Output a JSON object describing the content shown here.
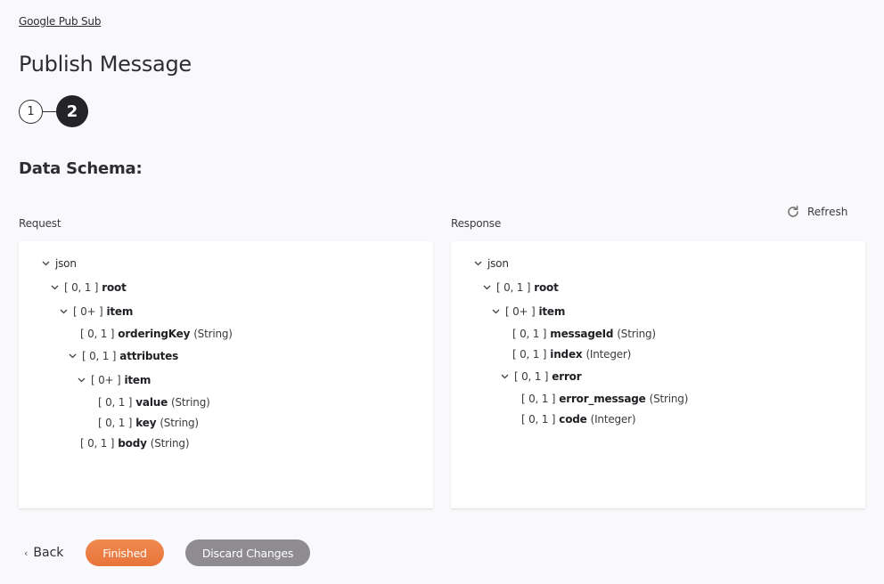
{
  "breadcrumb": "Google Pub Sub",
  "title": "Publish Message",
  "stepper": {
    "steps": [
      "1",
      "2"
    ],
    "current": 2
  },
  "section_title": "Data Schema:",
  "refresh_label": "Refresh",
  "request": {
    "label": "Request",
    "nodes": [
      {
        "depth": 0,
        "expandable": true,
        "card": "",
        "name": "json",
        "type": "",
        "plain": true
      },
      {
        "depth": 1,
        "expandable": true,
        "card": "[ 0, 1 ]",
        "name": "root",
        "type": ""
      },
      {
        "depth": 2,
        "expandable": true,
        "card": "[ 0+ ]",
        "name": "item",
        "type": ""
      },
      {
        "depth": 3,
        "expandable": false,
        "card": "[ 0, 1 ]",
        "name": "orderingKey",
        "type": "(String)"
      },
      {
        "depth": 3,
        "expandable": true,
        "card": "[ 0, 1 ]",
        "name": "attributes",
        "type": ""
      },
      {
        "depth": 4,
        "expandable": true,
        "card": "[ 0+ ]",
        "name": "item",
        "type": ""
      },
      {
        "depth": 5,
        "expandable": false,
        "card": "[ 0, 1 ]",
        "name": "value",
        "type": "(String)"
      },
      {
        "depth": 5,
        "expandable": false,
        "card": "[ 0, 1 ]",
        "name": "key",
        "type": "(String)"
      },
      {
        "depth": 3,
        "expandable": false,
        "card": "[ 0, 1 ]",
        "name": "body",
        "type": "(String)"
      }
    ]
  },
  "response": {
    "label": "Response",
    "nodes": [
      {
        "depth": 0,
        "expandable": true,
        "card": "",
        "name": "json",
        "type": "",
        "plain": true
      },
      {
        "depth": 1,
        "expandable": true,
        "card": "[ 0, 1 ]",
        "name": "root",
        "type": ""
      },
      {
        "depth": 2,
        "expandable": true,
        "card": "[ 0+ ]",
        "name": "item",
        "type": ""
      },
      {
        "depth": 3,
        "expandable": false,
        "card": "[ 0, 1 ]",
        "name": "messageId",
        "type": "(String)"
      },
      {
        "depth": 3,
        "expandable": false,
        "card": "[ 0, 1 ]",
        "name": "index",
        "type": "(Integer)"
      },
      {
        "depth": 3,
        "expandable": true,
        "card": "[ 0, 1 ]",
        "name": "error",
        "type": ""
      },
      {
        "depth": 4,
        "expandable": false,
        "card": "[ 0, 1 ]",
        "name": "error_message",
        "type": "(String)"
      },
      {
        "depth": 4,
        "expandable": false,
        "card": "[ 0, 1 ]",
        "name": "code",
        "type": "(Integer)"
      }
    ]
  },
  "footer": {
    "back_label": "Back",
    "finished_label": "Finished",
    "discard_label": "Discard Changes"
  },
  "colors": {
    "finished": "#ec7d43",
    "discard": "#8e8b91",
    "active_step": "#242428"
  }
}
